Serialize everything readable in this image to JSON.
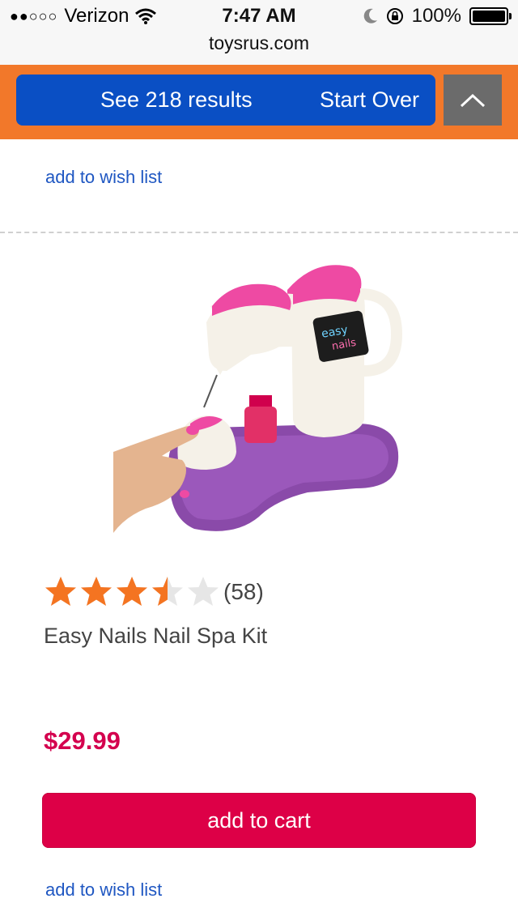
{
  "status_bar": {
    "signal_dots": "●●○○○",
    "carrier": "Verizon",
    "time": "7:47 AM",
    "battery": "100%",
    "battery_level": 1.0,
    "icons": [
      "wifi-icon",
      "moon-icon",
      "orientation-lock-icon",
      "battery-icon"
    ]
  },
  "browser": {
    "url": "toysrus.com"
  },
  "filter_bar": {
    "see_results": "See 218 results",
    "start_over": "Start Over",
    "collapse_icon": "chevron-up-icon",
    "colors": {
      "bar": "#f2782a",
      "button": "#0a4fc4",
      "collapse": "#6b6b6b"
    }
  },
  "previous_product": {
    "wish_list": "add to wish list"
  },
  "product": {
    "image_alt": "Easy Nails Nail Spa Kit product image",
    "rating": {
      "value": 3.5,
      "max": 5,
      "count_label": "(58)"
    },
    "name": "Easy Nails Nail Spa Kit",
    "price": "$29.99",
    "add_to_cart": "add to cart",
    "wish_list": "add to wish list",
    "colors": {
      "star": "#f47421",
      "price": "#d4004e",
      "cart": "#dd0047",
      "link": "#1f57c2"
    }
  }
}
